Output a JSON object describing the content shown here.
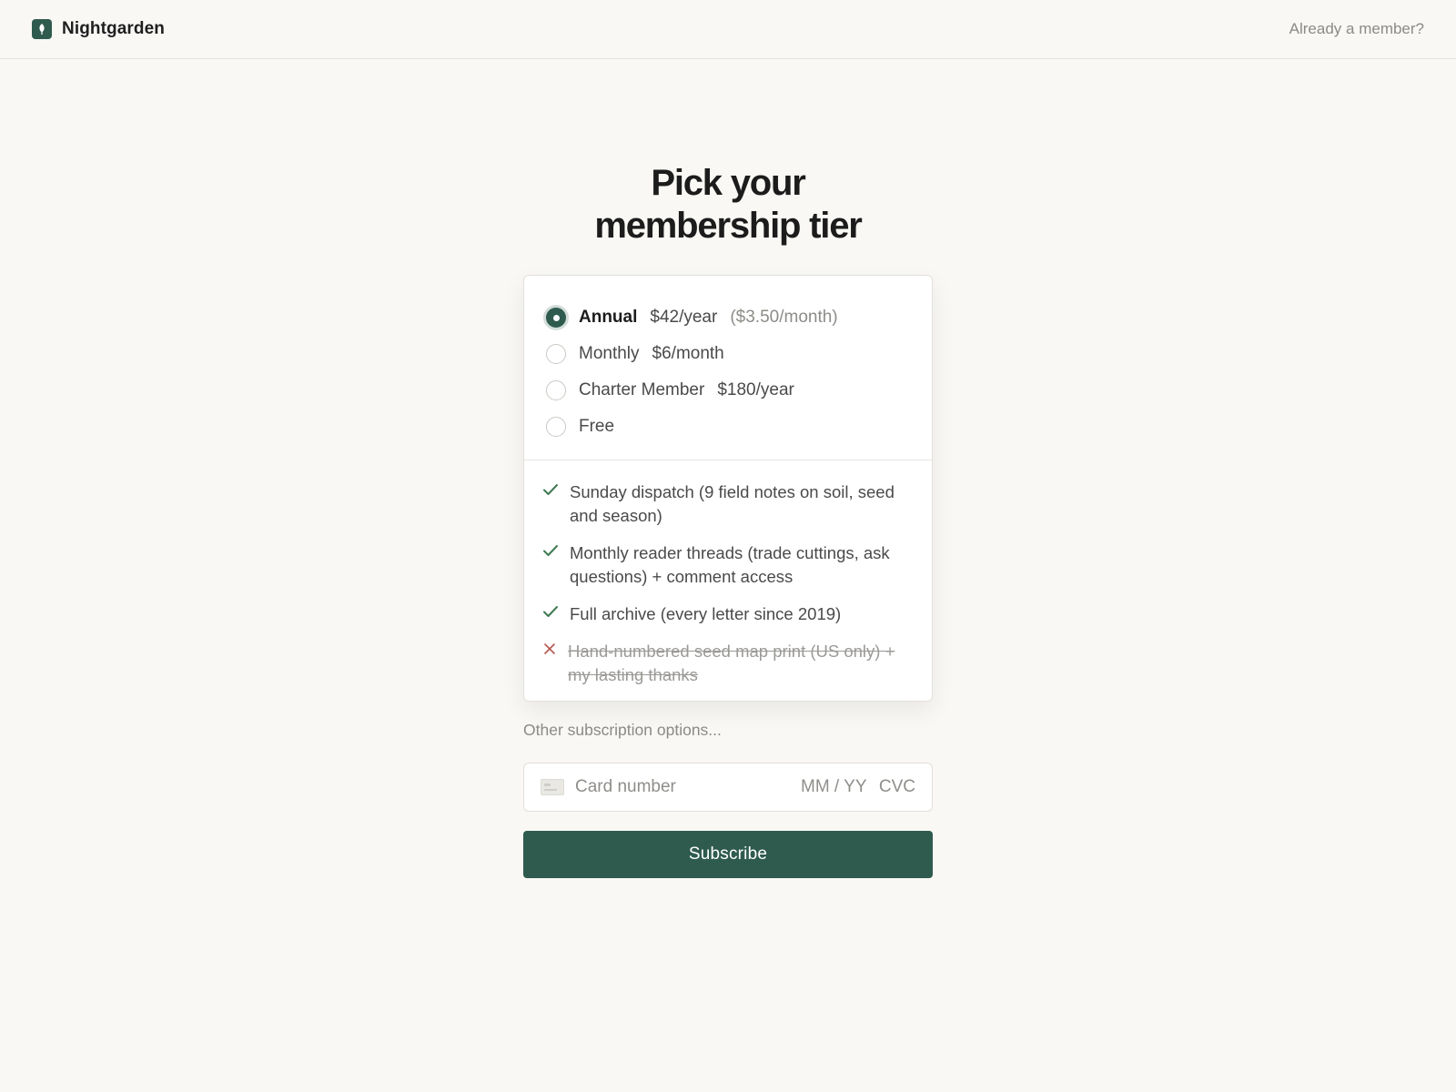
{
  "header": {
    "brand_name": "Nightgarden",
    "logo_icon": "leaf-icon",
    "member_link": "Already a member?"
  },
  "title": {
    "line1": "Pick your",
    "line2": "membership tier"
  },
  "tiers": [
    {
      "name": "Annual",
      "price": "$42/year",
      "note": "($3.50/month)",
      "selected": true
    },
    {
      "name": "Monthly",
      "price": "$6/month",
      "note": "",
      "selected": false
    },
    {
      "name": "Charter Member",
      "price": "$180/year",
      "note": "",
      "selected": false
    },
    {
      "name": "Free",
      "price": "",
      "note": "",
      "selected": false
    }
  ],
  "features": [
    {
      "text": "Sunday dispatch (9 field notes on soil, seed and season)",
      "included": true,
      "icon": "check-icon"
    },
    {
      "text": "Monthly reader threads (trade cuttings, ask questions) + comment access",
      "included": true,
      "icon": "check-icon"
    },
    {
      "text": "Full archive (every letter since 2019)",
      "included": true,
      "icon": "check-icon"
    },
    {
      "text": "Hand-numbered seed map print (US only) + my lasting thanks",
      "included": false,
      "icon": "cross-icon"
    }
  ],
  "other_options": "Other subscription options...",
  "payment": {
    "card_icon": "credit-card-icon",
    "card_placeholder": "Card number",
    "expiry_placeholder": "MM / YY",
    "cvc_placeholder": "CVC"
  },
  "subscribe_label": "Subscribe",
  "colors": {
    "accent": "#2f5b4f",
    "check": "#3e7a52",
    "cross": "#b5574e",
    "background": "#f9f8f5"
  }
}
